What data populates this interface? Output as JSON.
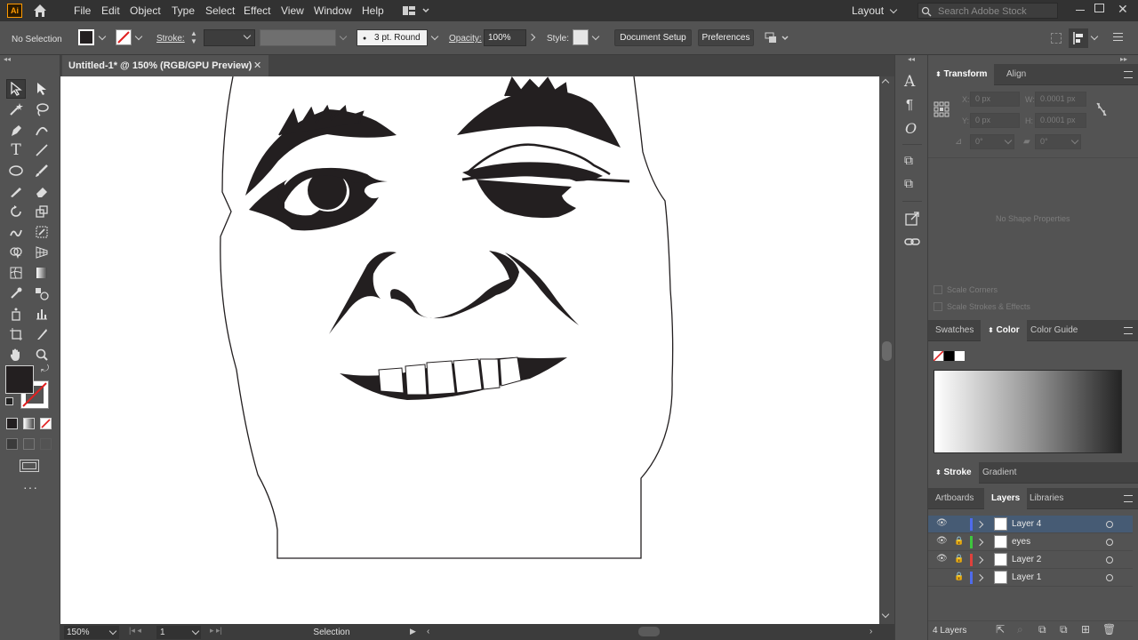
{
  "app": {
    "logo": "Ai",
    "workspace": "Layout",
    "search_placeholder": "Search Adobe Stock"
  },
  "menu": [
    "File",
    "Edit",
    "Object",
    "Type",
    "Select",
    "Effect",
    "View",
    "Window",
    "Help"
  ],
  "control": {
    "selection_status": "No Selection",
    "stroke_label": "Stroke:",
    "brush_value": "3 pt. Round",
    "opacity_label": "Opacity:",
    "opacity_value": "100%",
    "style_label": "Style:",
    "document_setup": "Document Setup",
    "preferences": "Preferences"
  },
  "document": {
    "tab_title": "Untitled-1* @ 150% (RGB/GPU Preview)"
  },
  "statusbar": {
    "zoom": "150%",
    "artboard": "1",
    "tool": "Selection"
  },
  "transform": {
    "tabs": [
      "Transform",
      "Align"
    ],
    "x_label": "X:",
    "x_value": "0 px",
    "y_label": "Y:",
    "y_value": "0 px",
    "w_label": "W:",
    "w_value": "0.0001 px",
    "h_label": "H:",
    "h_value": "0.0001 px",
    "angle_value": "0°",
    "shear_value": "0°",
    "no_shape": "No Shape Properties",
    "scale_corners": "Scale Corners",
    "scale_strokes": "Scale Strokes & Effects"
  },
  "color_panel": {
    "tabs": [
      "Swatches",
      "Color",
      "Color Guide"
    ]
  },
  "stroke_panel": {
    "tabs": [
      "Stroke",
      "Gradient"
    ]
  },
  "layers_panel": {
    "tabs": [
      "Artboards",
      "Layers",
      "Libraries"
    ],
    "layers": [
      {
        "name": "Layer 4",
        "color": "#4f6bed"
      },
      {
        "name": "eyes",
        "color": "#3ec63e"
      },
      {
        "name": "Layer 2",
        "color": "#e0413c"
      },
      {
        "name": "Layer 1",
        "color": "#4f6bed"
      }
    ],
    "count": "4 Layers"
  },
  "colors": {
    "ui_dark": "#323232",
    "ui_mid": "#535353",
    "selection": "#465b74",
    "ink": "#231f20"
  }
}
